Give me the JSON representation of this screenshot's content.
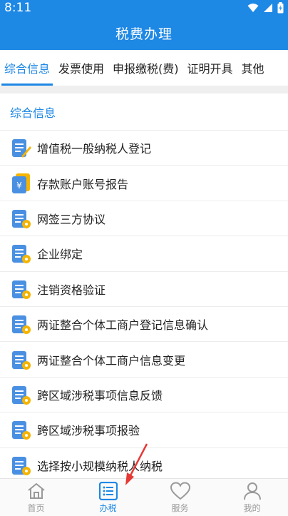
{
  "status_bar": {
    "time": "8:11"
  },
  "app_bar": {
    "title": "税费办理"
  },
  "tabs": [
    {
      "label": "综合信息",
      "active": true
    },
    {
      "label": "发票使用"
    },
    {
      "label": "申报缴税(费)"
    },
    {
      "label": "证明开具"
    },
    {
      "label": "其他"
    }
  ],
  "section": {
    "title": "综合信息"
  },
  "items": [
    {
      "label": "增值税一般纳税人登记",
      "icon": "edit-document-icon"
    },
    {
      "label": "存款账户账号报告",
      "icon": "yuan-document-icon"
    },
    {
      "label": "网签三方协议",
      "icon": "document-badge-icon"
    },
    {
      "label": "企业绑定",
      "icon": "document-badge-icon"
    },
    {
      "label": "注销资格验证",
      "icon": "document-badge-icon"
    },
    {
      "label": "两证整合个体工商户登记信息确认",
      "icon": "document-badge-icon"
    },
    {
      "label": "两证整合个体工商户信息变更",
      "icon": "document-badge-icon"
    },
    {
      "label": "跨区域涉税事项信息反馈",
      "icon": "document-badge-icon"
    },
    {
      "label": "跨区域涉税事项报验",
      "icon": "document-badge-icon"
    },
    {
      "label": "选择按小规模纳税人纳税",
      "icon": "document-badge-icon"
    }
  ],
  "bottom_nav": [
    {
      "label": "首页",
      "icon": "home-icon"
    },
    {
      "label": "办税",
      "icon": "list-icon",
      "active": true
    },
    {
      "label": "服务",
      "icon": "heart-icon"
    },
    {
      "label": "我的",
      "icon": "person-icon"
    }
  ],
  "colors": {
    "primary": "#1e88e5",
    "badge": "#f5b400",
    "arrow": "#e53935"
  }
}
